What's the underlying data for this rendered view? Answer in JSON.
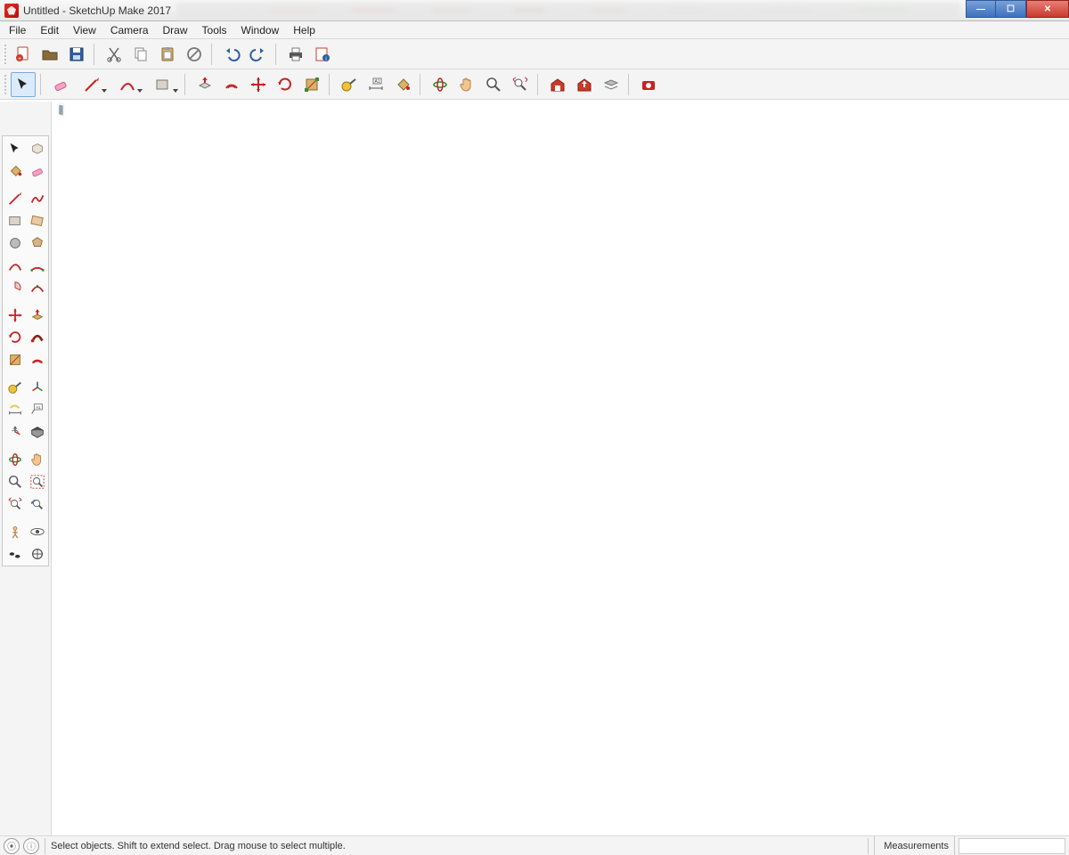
{
  "window": {
    "title": "Untitled - SketchUp Make 2017"
  },
  "menu": [
    "File",
    "Edit",
    "View",
    "Camera",
    "Draw",
    "Tools",
    "Window",
    "Help"
  ],
  "toolbar1_names": [
    "new-file",
    "open-file",
    "save-file",
    "cut",
    "copy",
    "paste",
    "erase",
    "undo",
    "redo",
    "print",
    "model-info"
  ],
  "toolbar2_names": [
    "select",
    "eraser",
    "line",
    "arc",
    "rectangle",
    "circle",
    "push-pull",
    "offset",
    "move",
    "rotate",
    "scale",
    "tape-measure",
    "text",
    "dimension",
    "paint-bucket",
    "orbit",
    "pan",
    "zoom",
    "zoom-extents",
    "zoom-window",
    "get-models",
    "share-model",
    "upload",
    "extensions",
    "ruby"
  ],
  "palette_rows": [
    [
      "select",
      "make-component"
    ],
    [
      "paint-bucket",
      "eraser"
    ],
    [
      "gap"
    ],
    [
      "line",
      "freehand"
    ],
    [
      "rectangle",
      "rotated-rectangle"
    ],
    [
      "circle",
      "polygon"
    ],
    [
      "arc",
      "two-point-arc"
    ],
    [
      "pie",
      "three-point-arc"
    ],
    [
      "gap"
    ],
    [
      "move",
      "push-pull"
    ],
    [
      "rotate",
      "follow-me"
    ],
    [
      "scale",
      "offset"
    ],
    [
      "gap"
    ],
    [
      "tape",
      "axes"
    ],
    [
      "dimension",
      "text"
    ],
    [
      "protractor",
      "section"
    ],
    [
      "gap"
    ],
    [
      "orbit",
      "pan"
    ],
    [
      "zoom",
      "zoom-window"
    ],
    [
      "zoom-extents",
      "previous-view"
    ],
    [
      "gap"
    ],
    [
      "position-camera",
      "look-around"
    ],
    [
      "walk",
      "xray"
    ]
  ],
  "status": {
    "hint": "Select objects. Shift to extend select. Drag mouse to select multiple.",
    "measurements_label": "Measurements",
    "measurements_value": ""
  },
  "colors": {
    "glass": "#90a4af",
    "frame": "#c9cfd3"
  }
}
